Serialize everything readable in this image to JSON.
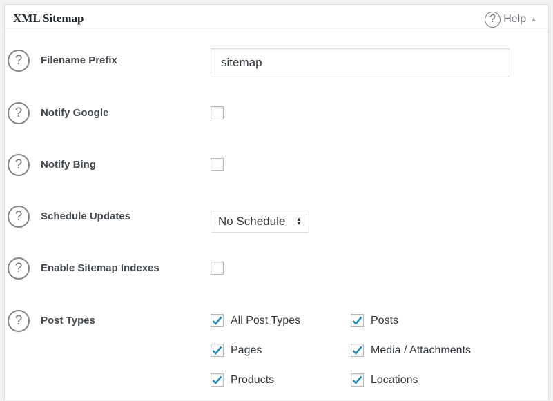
{
  "panel": {
    "title": "XML Sitemap",
    "help_label": "Help",
    "help_icon": "question-mark-circle-icon",
    "help_arrow_icon": "triangle-up-icon"
  },
  "fields": {
    "filename_prefix": {
      "label": "Filename Prefix",
      "value": "sitemap"
    },
    "notify_google": {
      "label": "Notify Google",
      "checked": false
    },
    "notify_bing": {
      "label": "Notify Bing",
      "checked": false
    },
    "schedule_updates": {
      "label": "Schedule Updates",
      "selected": "No Schedule"
    },
    "enable_indexes": {
      "label": "Enable Sitemap Indexes",
      "checked": false
    },
    "post_types": {
      "label": "Post Types",
      "options": [
        {
          "label": "All Post Types",
          "checked": true
        },
        {
          "label": "Posts",
          "checked": true
        },
        {
          "label": "Pages",
          "checked": true
        },
        {
          "label": "Media / Attachments",
          "checked": true
        },
        {
          "label": "Products",
          "checked": true
        },
        {
          "label": "Locations",
          "checked": true
        }
      ]
    }
  },
  "colors": {
    "check": "#1e8cbe",
    "label": "#444a4f",
    "border": "#dddddd"
  }
}
